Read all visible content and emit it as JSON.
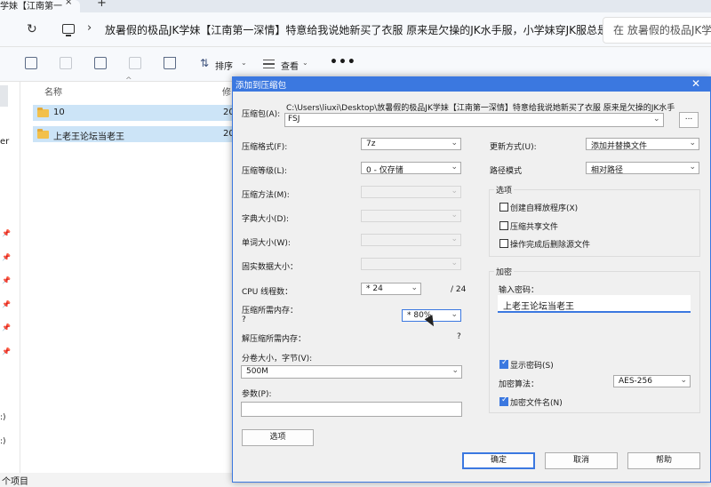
{
  "explorer": {
    "tab_title": "学妹【江南第一",
    "tab_close": "×",
    "new_tab": "+",
    "breadcrumb_path": "放暑假的极品JK学妹【江南第一深情】特意给我说她新买了衣服 原来是欠操的JK水手服，小学妹穿JK服总是",
    "search_placeholder": "在 放暑假的极品JK学妹",
    "sort_label": "排序",
    "view_label": "查看",
    "more_label": "•••",
    "column_name": "名称",
    "column_date": "修",
    "nav_partial_label": "er",
    "left_partial_1": ":)",
    "left_partial_2": ":)",
    "files": [
      {
        "name": "10",
        "date": "20"
      },
      {
        "name": "上老王论坛当老王",
        "date": "20"
      }
    ],
    "status_text": "个项目"
  },
  "dialog": {
    "title": "添加到压缩包",
    "close": "✕",
    "archive_label": "压缩包(A):",
    "archive_path_line1": "C:\\Users\\liuxi\\Desktop\\放暑假的极品JK学妹【江南第一深情】特意给我说她新买了衣服 原来是欠操的JK水手",
    "archive_path_line2": "FSJ",
    "browse_button": "...",
    "format_label": "压缩格式(F):",
    "format_value": "7z",
    "level_label": "压缩等级(L):",
    "level_value": "0 - 仅存储",
    "method_label": "压缩方法(M):",
    "dict_label": "字典大小(D):",
    "word_label": "单词大小(W):",
    "solid_label": "固实数据大小：",
    "threads_label": "CPU 线程数：",
    "threads_value": "* 24",
    "threads_max": "/ 24",
    "mem_comp_label": "压缩所需内存：",
    "mem_comp_q": "?",
    "mem_comp_value": "* 80%",
    "mem_decomp_label": "解压缩所需内存：",
    "mem_decomp_q": "?",
    "split_label": "分卷大小，字节(V):",
    "split_value": "500M",
    "params_label": "参数(P):",
    "options_button": "选项",
    "update_label": "更新方式(U):",
    "update_value": "添加并替换文件",
    "path_mode_label": "路径模式",
    "path_mode_value": "相对路径",
    "options_group": "选项",
    "opt_sfx": "创建自释放程序(X)",
    "opt_shared": "压缩共享文件",
    "opt_delete": "操作完成后删除源文件",
    "encryption_group": "加密",
    "password_label": "输入密码：",
    "password_value": "上老王论坛当老王",
    "show_password": "显示密码(S)",
    "enc_method_label": "加密算法：",
    "enc_method_value": "AES-256",
    "encrypt_names": "加密文件名(N)",
    "ok_button": "确定",
    "cancel_button": "取消",
    "help_button": "帮助"
  },
  "colors": {
    "accent": "#3b78e0",
    "selection": "#cce4f7",
    "folder": "#f2c04b"
  }
}
